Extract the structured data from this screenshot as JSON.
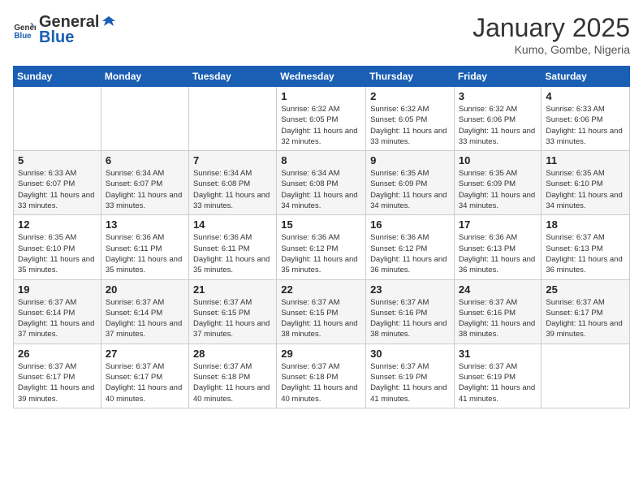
{
  "header": {
    "logo_general": "General",
    "logo_blue": "Blue",
    "month_year": "January 2025",
    "location": "Kumo, Gombe, Nigeria"
  },
  "days_of_week": [
    "Sunday",
    "Monday",
    "Tuesday",
    "Wednesday",
    "Thursday",
    "Friday",
    "Saturday"
  ],
  "weeks": [
    {
      "days": [
        {
          "num": "",
          "sunrise": "",
          "sunset": "",
          "daylight": ""
        },
        {
          "num": "",
          "sunrise": "",
          "sunset": "",
          "daylight": ""
        },
        {
          "num": "",
          "sunrise": "",
          "sunset": "",
          "daylight": ""
        },
        {
          "num": "1",
          "sunrise": "Sunrise: 6:32 AM",
          "sunset": "Sunset: 6:05 PM",
          "daylight": "Daylight: 11 hours and 32 minutes."
        },
        {
          "num": "2",
          "sunrise": "Sunrise: 6:32 AM",
          "sunset": "Sunset: 6:05 PM",
          "daylight": "Daylight: 11 hours and 33 minutes."
        },
        {
          "num": "3",
          "sunrise": "Sunrise: 6:32 AM",
          "sunset": "Sunset: 6:06 PM",
          "daylight": "Daylight: 11 hours and 33 minutes."
        },
        {
          "num": "4",
          "sunrise": "Sunrise: 6:33 AM",
          "sunset": "Sunset: 6:06 PM",
          "daylight": "Daylight: 11 hours and 33 minutes."
        }
      ]
    },
    {
      "days": [
        {
          "num": "5",
          "sunrise": "Sunrise: 6:33 AM",
          "sunset": "Sunset: 6:07 PM",
          "daylight": "Daylight: 11 hours and 33 minutes."
        },
        {
          "num": "6",
          "sunrise": "Sunrise: 6:34 AM",
          "sunset": "Sunset: 6:07 PM",
          "daylight": "Daylight: 11 hours and 33 minutes."
        },
        {
          "num": "7",
          "sunrise": "Sunrise: 6:34 AM",
          "sunset": "Sunset: 6:08 PM",
          "daylight": "Daylight: 11 hours and 33 minutes."
        },
        {
          "num": "8",
          "sunrise": "Sunrise: 6:34 AM",
          "sunset": "Sunset: 6:08 PM",
          "daylight": "Daylight: 11 hours and 34 minutes."
        },
        {
          "num": "9",
          "sunrise": "Sunrise: 6:35 AM",
          "sunset": "Sunset: 6:09 PM",
          "daylight": "Daylight: 11 hours and 34 minutes."
        },
        {
          "num": "10",
          "sunrise": "Sunrise: 6:35 AM",
          "sunset": "Sunset: 6:09 PM",
          "daylight": "Daylight: 11 hours and 34 minutes."
        },
        {
          "num": "11",
          "sunrise": "Sunrise: 6:35 AM",
          "sunset": "Sunset: 6:10 PM",
          "daylight": "Daylight: 11 hours and 34 minutes."
        }
      ]
    },
    {
      "days": [
        {
          "num": "12",
          "sunrise": "Sunrise: 6:35 AM",
          "sunset": "Sunset: 6:10 PM",
          "daylight": "Daylight: 11 hours and 35 minutes."
        },
        {
          "num": "13",
          "sunrise": "Sunrise: 6:36 AM",
          "sunset": "Sunset: 6:11 PM",
          "daylight": "Daylight: 11 hours and 35 minutes."
        },
        {
          "num": "14",
          "sunrise": "Sunrise: 6:36 AM",
          "sunset": "Sunset: 6:11 PM",
          "daylight": "Daylight: 11 hours and 35 minutes."
        },
        {
          "num": "15",
          "sunrise": "Sunrise: 6:36 AM",
          "sunset": "Sunset: 6:12 PM",
          "daylight": "Daylight: 11 hours and 35 minutes."
        },
        {
          "num": "16",
          "sunrise": "Sunrise: 6:36 AM",
          "sunset": "Sunset: 6:12 PM",
          "daylight": "Daylight: 11 hours and 36 minutes."
        },
        {
          "num": "17",
          "sunrise": "Sunrise: 6:36 AM",
          "sunset": "Sunset: 6:13 PM",
          "daylight": "Daylight: 11 hours and 36 minutes."
        },
        {
          "num": "18",
          "sunrise": "Sunrise: 6:37 AM",
          "sunset": "Sunset: 6:13 PM",
          "daylight": "Daylight: 11 hours and 36 minutes."
        }
      ]
    },
    {
      "days": [
        {
          "num": "19",
          "sunrise": "Sunrise: 6:37 AM",
          "sunset": "Sunset: 6:14 PM",
          "daylight": "Daylight: 11 hours and 37 minutes."
        },
        {
          "num": "20",
          "sunrise": "Sunrise: 6:37 AM",
          "sunset": "Sunset: 6:14 PM",
          "daylight": "Daylight: 11 hours and 37 minutes."
        },
        {
          "num": "21",
          "sunrise": "Sunrise: 6:37 AM",
          "sunset": "Sunset: 6:15 PM",
          "daylight": "Daylight: 11 hours and 37 minutes."
        },
        {
          "num": "22",
          "sunrise": "Sunrise: 6:37 AM",
          "sunset": "Sunset: 6:15 PM",
          "daylight": "Daylight: 11 hours and 38 minutes."
        },
        {
          "num": "23",
          "sunrise": "Sunrise: 6:37 AM",
          "sunset": "Sunset: 6:16 PM",
          "daylight": "Daylight: 11 hours and 38 minutes."
        },
        {
          "num": "24",
          "sunrise": "Sunrise: 6:37 AM",
          "sunset": "Sunset: 6:16 PM",
          "daylight": "Daylight: 11 hours and 38 minutes."
        },
        {
          "num": "25",
          "sunrise": "Sunrise: 6:37 AM",
          "sunset": "Sunset: 6:17 PM",
          "daylight": "Daylight: 11 hours and 39 minutes."
        }
      ]
    },
    {
      "days": [
        {
          "num": "26",
          "sunrise": "Sunrise: 6:37 AM",
          "sunset": "Sunset: 6:17 PM",
          "daylight": "Daylight: 11 hours and 39 minutes."
        },
        {
          "num": "27",
          "sunrise": "Sunrise: 6:37 AM",
          "sunset": "Sunset: 6:17 PM",
          "daylight": "Daylight: 11 hours and 40 minutes."
        },
        {
          "num": "28",
          "sunrise": "Sunrise: 6:37 AM",
          "sunset": "Sunset: 6:18 PM",
          "daylight": "Daylight: 11 hours and 40 minutes."
        },
        {
          "num": "29",
          "sunrise": "Sunrise: 6:37 AM",
          "sunset": "Sunset: 6:18 PM",
          "daylight": "Daylight: 11 hours and 40 minutes."
        },
        {
          "num": "30",
          "sunrise": "Sunrise: 6:37 AM",
          "sunset": "Sunset: 6:19 PM",
          "daylight": "Daylight: 11 hours and 41 minutes."
        },
        {
          "num": "31",
          "sunrise": "Sunrise: 6:37 AM",
          "sunset": "Sunset: 6:19 PM",
          "daylight": "Daylight: 11 hours and 41 minutes."
        },
        {
          "num": "",
          "sunrise": "",
          "sunset": "",
          "daylight": ""
        }
      ]
    }
  ]
}
